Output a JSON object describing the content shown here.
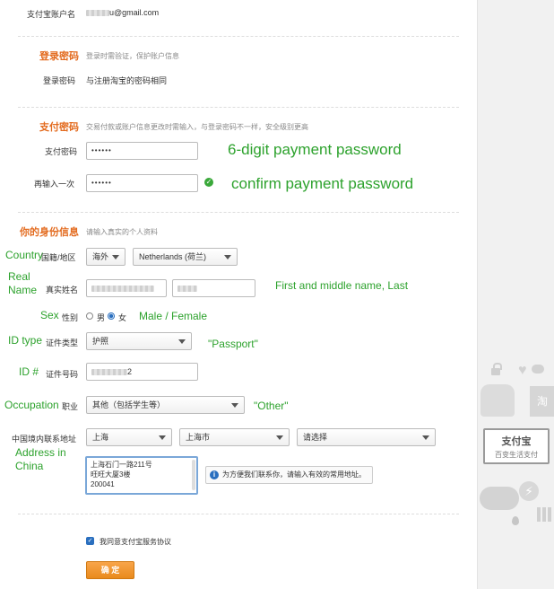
{
  "account": {
    "label": "支付宝账户名",
    "email_visible": "u@gmail.com"
  },
  "login_pw": {
    "title": "登录密码",
    "hint": "登录时需验证，保护账户信息",
    "field_label": "登录密码",
    "value": "与注册淘宝的密码相同"
  },
  "pay_pw": {
    "title": "支付密码",
    "hint": "交易付款或账户信息更改时需输入，与登录密码不一样，安全级别更高",
    "field_label": "支付密码",
    "value": "••••••",
    "confirm_label": "再输入一次",
    "confirm_value": "••••••"
  },
  "identity": {
    "title": "你的身份信息",
    "hint": "请输入真实的个人资料",
    "country_label": "国籍/地区",
    "country_region": "海外",
    "country_value": "Netherlands (荷兰)",
    "name_label": "真实姓名",
    "sex_label": "性别",
    "sex_male": "男",
    "sex_female": "女",
    "id_type_label": "证件类型",
    "id_type_value": "护照",
    "id_no_label": "证件号码",
    "id_no_visible": "2",
    "occupation_label": "职业",
    "occupation_value": "其他（包括学生等）",
    "address_label": "中国境内联系地址",
    "province": "上海",
    "city": "上海市",
    "district": "请选择",
    "address_lines": [
      "上海石门一路211号",
      "旺旺大厦3楼",
      "200041"
    ],
    "address_tip": "为方便我们联系你，请输入有效的常用地址。"
  },
  "agreement": "我同意支付宝服务协议",
  "submit": "确 定",
  "annotations": {
    "pay_pw": "6-digit payment password",
    "confirm": "confirm payment password",
    "country": "Country",
    "real_name": [
      "Real",
      "Name"
    ],
    "name_note": "First and middle name, Last",
    "sex": "Sex",
    "sex_note": "Male / Female",
    "id_type": "ID type",
    "passport": "\"Passport\"",
    "id_no": "ID #",
    "occupation": "Occupation",
    "other": "\"Other\"",
    "address": [
      "Address in",
      "China"
    ]
  },
  "ad": {
    "logo": "支付宝",
    "slogan": "百变生活支付",
    "tao": "淘"
  },
  "colors": {
    "section_title": "#e36b1f",
    "annotation": "#2da22d",
    "submit": "#f19a32",
    "ok": "#3aa83a",
    "info": "#2a6fbf"
  }
}
